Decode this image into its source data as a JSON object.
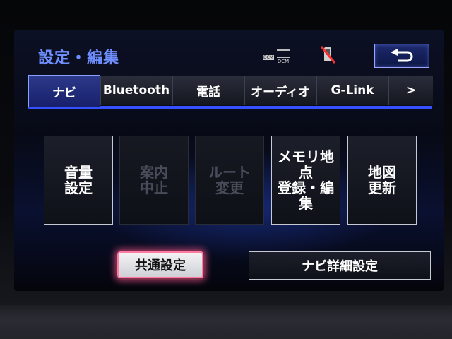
{
  "header": {
    "title": "設定・編集",
    "dcm_top": "DCM",
    "dcm_bottom": "DCM",
    "phone_icon": "phone-no-service-icon",
    "back_icon": "return-arrow-icon"
  },
  "tabs": [
    {
      "label": "ナビ",
      "active": true
    },
    {
      "label": "Bluetooth",
      "active": false
    },
    {
      "label": "電話",
      "active": false
    },
    {
      "label": "オーディオ",
      "active": false
    },
    {
      "label": "G-Link",
      "active": false
    },
    {
      "label": ">",
      "active": false
    }
  ],
  "menu_buttons": [
    {
      "label": "音量\n設定",
      "enabled": true
    },
    {
      "label": "案内\n中止",
      "enabled": false
    },
    {
      "label": "ルート\n変更",
      "enabled": false
    },
    {
      "label": "メモリ地点\n登録・編集",
      "enabled": true
    },
    {
      "label": "地図\n更新",
      "enabled": true
    }
  ],
  "bottom": {
    "common_settings": "共通設定",
    "nav_detail_settings": "ナビ詳細設定"
  },
  "colors": {
    "accent": "#3550ff",
    "title": "#6f8fff",
    "highlight": "#ff7aa0"
  }
}
